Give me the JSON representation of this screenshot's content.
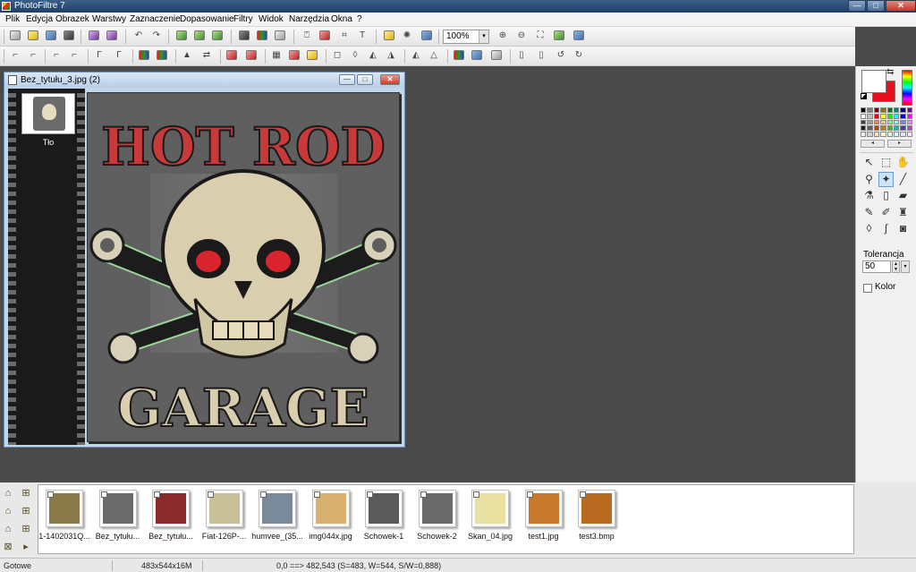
{
  "window": {
    "title": "PhotoFiltre 7",
    "min_glyph": "—",
    "max_glyph": "□",
    "close_glyph": "✕"
  },
  "menu": [
    "Plik",
    "Edycja",
    "Obrazek",
    "Warstwy",
    "Zaznaczenie",
    "Dopasowanie",
    "Filtry",
    "Widok",
    "Narzędzia",
    "Okna",
    "?"
  ],
  "toolbar": {
    "zoom": "100%",
    "zoom_drop": "▾"
  },
  "document": {
    "title": "Bez_tytułu_3.jpg (2)",
    "min_glyph": "—",
    "max_glyph": "□",
    "close_glyph": "✕",
    "layer_name": "Tło",
    "artwork_line1": "HOT ROD",
    "artwork_line2": "GARAGE"
  },
  "palette": {
    "swap_glyph": "⇆",
    "nav_left": "◂",
    "nav_right": "▸",
    "foreground_color": "#ffffff",
    "background_color": "#e8101c",
    "colors": [
      "#000000",
      "#808080",
      "#800000",
      "#808000",
      "#008000",
      "#008080",
      "#000080",
      "#800080",
      "#ffffff",
      "#c0c0c0",
      "#ff0000",
      "#ffff00",
      "#00ff00",
      "#00ffff",
      "#0000ff",
      "#ff00ff",
      "#404040",
      "#a0a0a0",
      "#ff8040",
      "#ffc080",
      "#80ff80",
      "#80ffff",
      "#8080ff",
      "#ff80ff",
      "#202020",
      "#606060",
      "#c04000",
      "#c08000",
      "#40c000",
      "#00c0c0",
      "#4040c0",
      "#c040c0",
      "#f0f0f0",
      "#d0d0d0",
      "#ffe0c0",
      "#ffffc0",
      "#e0ffe0",
      "#e0ffff",
      "#e0e0ff",
      "#ffe0ff"
    ],
    "tools": [
      {
        "name": "select-arrow-icon",
        "glyph": "↖"
      },
      {
        "name": "selection-rect-icon",
        "glyph": "⬚"
      },
      {
        "name": "hand-icon",
        "glyph": "✋"
      },
      {
        "name": "eyedropper-icon",
        "glyph": "⚲"
      },
      {
        "name": "magic-wand-icon",
        "glyph": "✦"
      },
      {
        "name": "line-icon",
        "glyph": "╱"
      },
      {
        "name": "fill-bucket-icon",
        "glyph": "⚗"
      },
      {
        "name": "spray-icon",
        "glyph": "▯"
      },
      {
        "name": "eraser-icon",
        "glyph": "▰"
      },
      {
        "name": "brush-icon",
        "glyph": "✎"
      },
      {
        "name": "advanced-brush-icon",
        "glyph": "✐"
      },
      {
        "name": "stamp-icon",
        "glyph": "♜"
      },
      {
        "name": "blur-drop-icon",
        "glyph": "◊"
      },
      {
        "name": "smudge-icon",
        "glyph": "∫"
      },
      {
        "name": "clone-icon",
        "glyph": "◙"
      }
    ],
    "tolerance_label": "Tolerancja",
    "tolerance_value": "50",
    "kolor_label": "Kolor",
    "spin_up": "▲",
    "spin_down": "▼",
    "drop_glyph": "▾"
  },
  "filebar": {
    "tool_glyphs": [
      "⌂",
      "⊞",
      "⌂",
      "⊞",
      "⌂",
      "⊞",
      "⊠",
      "▸"
    ],
    "files": [
      {
        "label": "1-1402031Q...",
        "color": "#8a7a4a"
      },
      {
        "label": "Bez_tytułu...",
        "color": "#6b6b6b"
      },
      {
        "label": "Bez_tytułu...",
        "color": "#8a2a2a"
      },
      {
        "label": "Fiat-126P-...",
        "color": "#c8c098"
      },
      {
        "label": "humvee_(35...",
        "color": "#7a8a9a"
      },
      {
        "label": "img044x.jpg",
        "color": "#d8b070"
      },
      {
        "label": "Schowek-1",
        "color": "#5a5a5a"
      },
      {
        "label": "Schowek-2",
        "color": "#6a6a6a"
      },
      {
        "label": "Skan_04.jpg",
        "color": "#e8e0a0"
      },
      {
        "label": "test1.jpg",
        "color": "#c8782a"
      },
      {
        "label": "test3.bmp",
        "color": "#b86a20"
      }
    ]
  },
  "status": {
    "state": "Gotowe",
    "dimensions": "483x544x16M",
    "coords": "0,0 ==> 482,543 (S=483, W=544, S/W=0,888)"
  }
}
